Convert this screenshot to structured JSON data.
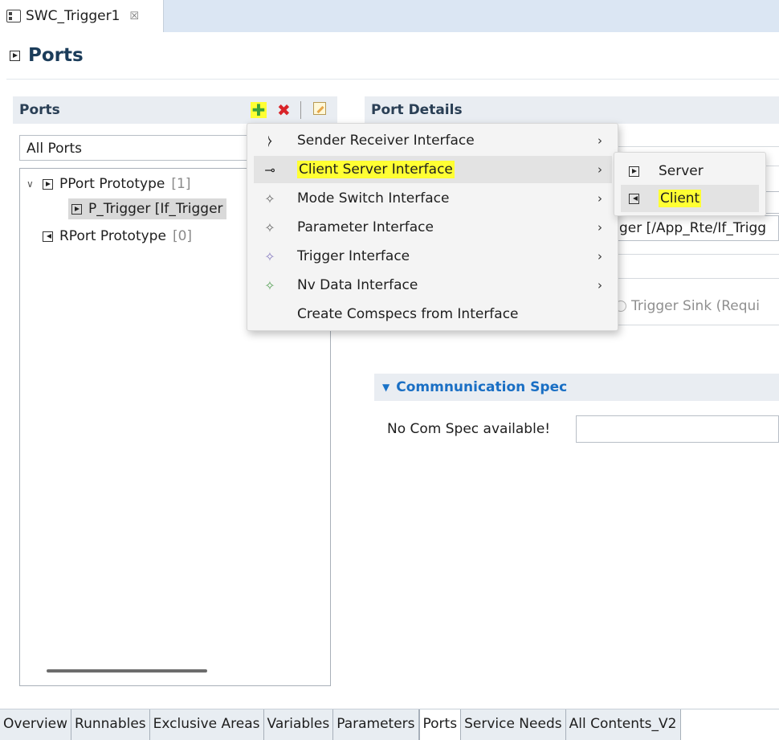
{
  "editor_tab": {
    "title": "SWC_Trigger1",
    "close": "☒"
  },
  "page": {
    "title": "Ports"
  },
  "ports_panel": {
    "header": "Ports",
    "filter": "All Ports",
    "tree": [
      {
        "label": "PPort Prototype",
        "count": "[1]"
      },
      {
        "label": "P_Trigger [If_Trigger"
      },
      {
        "label": "RPort Prototype",
        "count": "[0]"
      }
    ]
  },
  "details_panel": {
    "header": "Port Details",
    "interface_value": "ger [/App_Rte/If_Trigg",
    "radio_label": "Trigger Sink (Requi",
    "comm_spec_header": "Commnunication Spec",
    "no_com_spec": "No Com Spec available!"
  },
  "context_menu": {
    "items": [
      {
        "label": "Sender Receiver Interface",
        "icon": "sender-receiver-icon",
        "glyph": "⧽",
        "color": "#222222",
        "submenu": true
      },
      {
        "label": "Client Server Interface",
        "icon": "client-server-icon",
        "glyph": "⊸",
        "color": "#222222",
        "submenu": true,
        "highlighted": true
      },
      {
        "label": "Mode Switch Interface",
        "icon": "mode-switch-icon",
        "glyph": "✧",
        "color": "#666666",
        "submenu": true
      },
      {
        "label": "Parameter Interface",
        "icon": "parameter-icon",
        "glyph": "✧",
        "color": "#666666",
        "submenu": true
      },
      {
        "label": "Trigger Interface",
        "icon": "trigger-icon",
        "glyph": "✧",
        "color": "#8a7fc2",
        "submenu": true
      },
      {
        "label": "Nv Data Interface",
        "icon": "nv-data-icon",
        "glyph": "✧",
        "color": "#5aa35a",
        "submenu": true
      },
      {
        "label": "Create Comspecs from Interface",
        "icon": "",
        "glyph": "",
        "color": "#222222",
        "submenu": false
      }
    ],
    "chevron": "›"
  },
  "submenu": {
    "items": [
      {
        "label": "Server",
        "icon": "provided-port-icon"
      },
      {
        "label": "Client",
        "icon": "required-port-icon",
        "highlighted": true
      }
    ]
  },
  "bottom_tabs": [
    "Overview",
    "Runnables",
    "Exclusive Areas",
    "Variables",
    "Parameters",
    "Ports",
    "Service Needs",
    "All Contents_V2"
  ],
  "active_bottom_tab": "Ports"
}
